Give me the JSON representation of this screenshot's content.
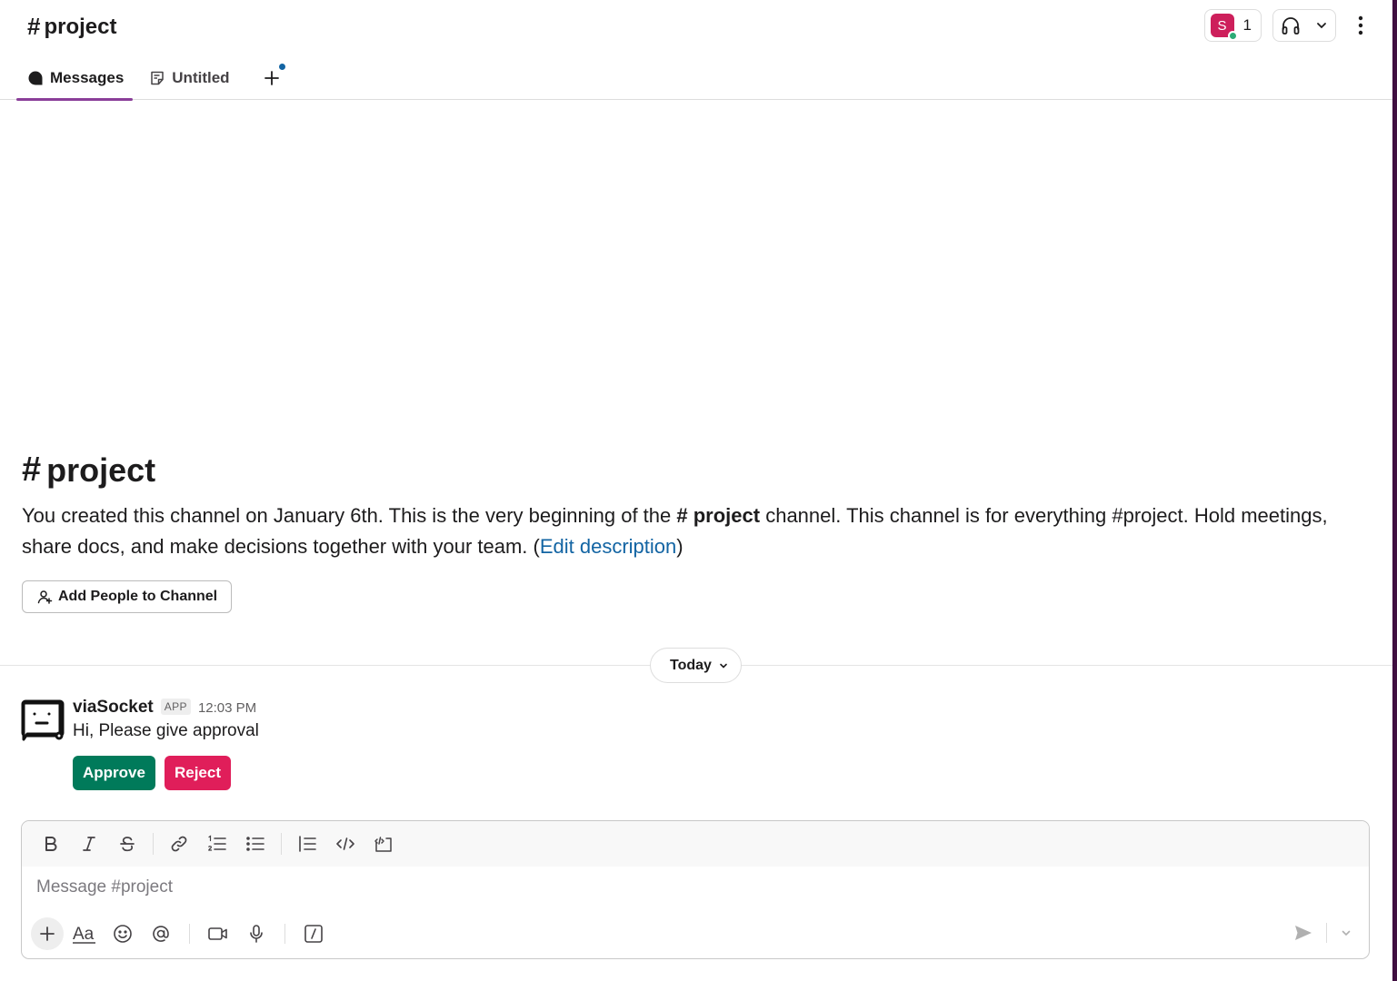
{
  "header": {
    "channel_name": "project",
    "members_avatar_initial": "S",
    "members_count": "1"
  },
  "tabs": [
    {
      "label": "Messages"
    },
    {
      "label": "Untitled"
    }
  ],
  "intro": {
    "title": "project",
    "text_before": "You created this channel on January 6th. This is the very beginning of the",
    "channel_ref": "# project",
    "text_after": "channel. This channel is for everything #project. Hold meetings, share docs, and make decisions together with your team. (",
    "edit_link": "Edit description",
    "text_close": ")",
    "add_people_label": "Add People to Channel"
  },
  "divider": {
    "label": "Today"
  },
  "message": {
    "author": "viaSocket",
    "badge": "APP",
    "time": "12:03 PM",
    "text": "Hi, Please give approval",
    "approve_label": "Approve",
    "reject_label": "Reject"
  },
  "composer": {
    "placeholder": "Message #project"
  },
  "colors": {
    "accent_tab": "#8a3e99",
    "approve": "#007a5a",
    "reject": "#e01e5a",
    "link": "#1264a3",
    "avatar": "#cd1f5b",
    "presence": "#2bac76",
    "workspace_strip": "#3f0e40"
  }
}
